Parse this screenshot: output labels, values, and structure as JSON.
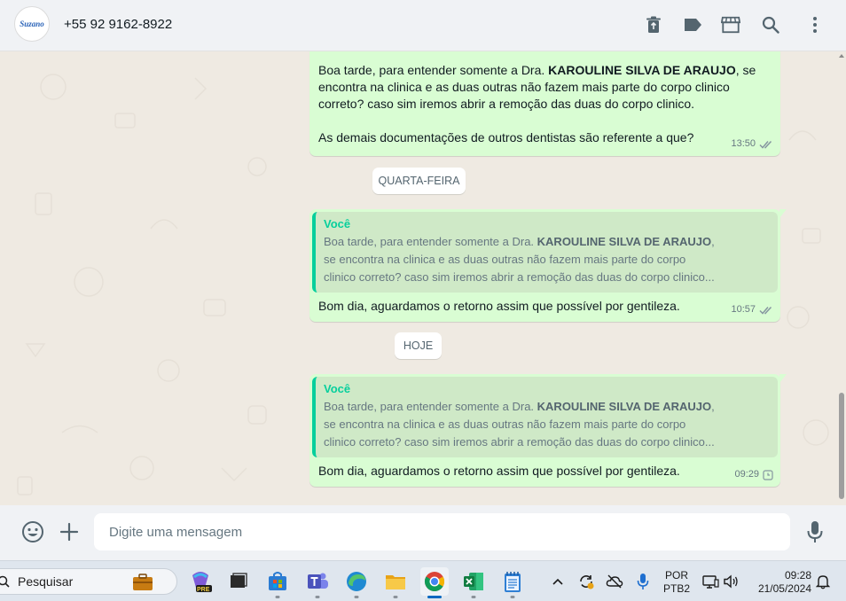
{
  "header": {
    "avatar_text": "Suzano",
    "contact_name": "+55 92 9162-8922",
    "icons": [
      "trash-icon",
      "label-icon",
      "store-icon",
      "search-icon",
      "menu-icon"
    ]
  },
  "messages": {
    "first": {
      "line1_prefix": "Boa tarde, para entender somente a Dra. ",
      "line1_bold": "KAROULINE SILVA DE ARAUJO",
      "line1_suffix": ", se",
      "line2": "encontra na clinica e as duas outras não fazem mais parte do corpo clinico",
      "line3": "correto? caso sim iremos abrir a remoção das duas do corpo clinico.",
      "line4": "As demais documentações de outros dentistas são referente a que?",
      "time": "13:50",
      "status": "read-icon"
    },
    "date1": "QUARTA-FEIRA",
    "second": {
      "quote_author": "Você",
      "quote_line1_prefix": "Boa tarde, para entender somente a Dra. ",
      "quote_line1_bold": "KAROULINE SILVA DE ARAUJO",
      "quote_line1_suffix": ",",
      "quote_line2": "se encontra na clinica e as duas outras não fazem mais parte do corpo",
      "quote_line3": "clinico correto? caso sim iremos abrir a remoção das duas do corpo clinico...",
      "text": "Bom dia, aguardamos o retorno assim que possível por gentileza.",
      "time": "10:57",
      "status": "read-icon"
    },
    "date2": "HOJE",
    "third": {
      "quote_author": "Você",
      "quote_line1_prefix": "Boa tarde, para entender somente a Dra. ",
      "quote_line1_bold": "KAROULINE SILVA DE ARAUJO",
      "quote_line1_suffix": ",",
      "quote_line2": "se encontra na clinica e as duas outras não fazem mais parte do corpo",
      "quote_line3": "clinico correto? caso sim iremos abrir a remoção das duas do corpo clinico...",
      "text": "Bom dia, aguardamos o retorno assim que possível por gentileza.",
      "time": "09:29",
      "status": "pending-clock-icon"
    }
  },
  "composer": {
    "placeholder": "Digite uma mensagem",
    "value": ""
  },
  "taskbar": {
    "search_label": "Pesquisar",
    "badge": "PRE",
    "lang_line1": "POR",
    "lang_line2": "PTB2",
    "time": "09:28",
    "date": "21/05/2024",
    "accent": "#0067c0"
  }
}
